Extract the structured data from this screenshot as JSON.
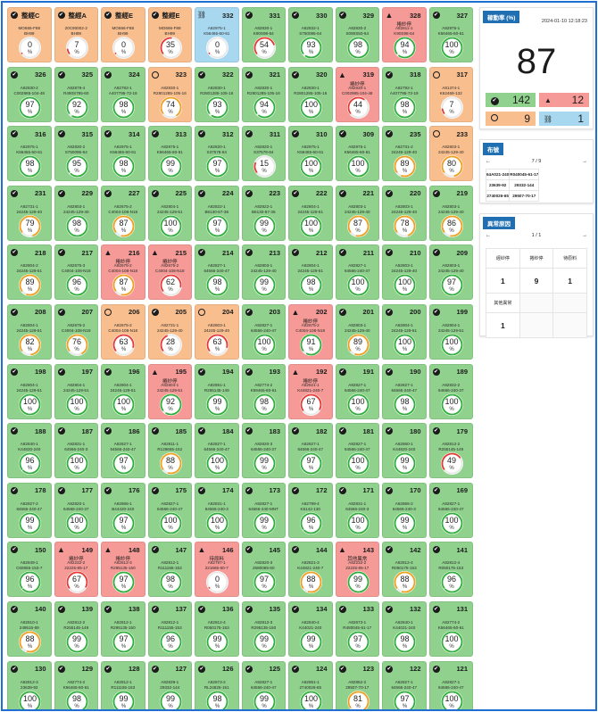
{
  "colors": {
    "green": "#8fd18d",
    "red": "#f59a96",
    "orange": "#f8be8e",
    "blue": "#a8d8f0",
    "accent": "#1f6fb2"
  },
  "tiles": [
    {
      "n": "整經C",
      "st": "ok",
      "c": "orange",
      "l1": "MO666-F88",
      "l2": "BH99",
      "v": "0"
    },
    {
      "n": "整經A",
      "st": "ok",
      "c": "orange",
      "l1": "20C90002-2",
      "l2": "BH99",
      "v": "7"
    },
    {
      "n": "整經E",
      "st": "ok",
      "c": "orange",
      "l1": "MO666-F88",
      "l2": "BH99",
      "v": "0"
    },
    {
      "n": "整經E",
      "st": "ok",
      "c": "orange",
      "l1": "MO666-F88",
      "l2": "BH99",
      "v": "35"
    },
    {
      "n": "332",
      "st": "off",
      "c": "blue",
      "l1": "A82975-1",
      "l2": "K56465-60-61",
      "v": "0"
    },
    {
      "n": "331",
      "st": "ok",
      "c": "green",
      "l1": "A82830-1",
      "l2": "K90S98-64",
      "v": "54"
    },
    {
      "n": "330",
      "st": "ok",
      "c": "green",
      "l1": "A82832-1",
      "l2": "S750095-64",
      "v": "93"
    },
    {
      "n": "329",
      "st": "ok",
      "c": "green",
      "l1": "A82830-2",
      "l2": "S090S50-64",
      "v": "98"
    },
    {
      "n": "328",
      "st": "warn",
      "c": "red",
      "a": "捲紗停",
      "l1": "A82811-1",
      "l2": "K90S98-64",
      "v": "94"
    },
    {
      "n": "327",
      "st": "ok",
      "c": "green",
      "l1": "A82975-1",
      "l2": "K56465-60-61",
      "v": "100"
    },
    {
      "n": "326",
      "st": "ok",
      "c": "green",
      "l1": "A82830-2",
      "l2": "C002985-104-48",
      "v": "97"
    },
    {
      "n": "325",
      "st": "ok",
      "c": "green",
      "l1": "A82879-4",
      "l2": "R490S795-60",
      "v": "92"
    },
    {
      "n": "324",
      "st": "ok",
      "c": "green",
      "l1": "A82792-1",
      "l2": "A407795-73-19",
      "v": "98"
    },
    {
      "n": "323",
      "st": "idle",
      "c": "orange",
      "l1": "A82830-1",
      "l2": "R2801285-105-16",
      "v": "74"
    },
    {
      "n": "322",
      "st": "ok",
      "c": "green",
      "l1": "A82830-1",
      "l2": "R2801285-105-16",
      "v": "93"
    },
    {
      "n": "321",
      "st": "ok",
      "c": "green",
      "l1": "A82830-1",
      "l2": "R2801285-105-16",
      "v": "94"
    },
    {
      "n": "320",
      "st": "ok",
      "c": "green",
      "l1": "A82830-1",
      "l2": "R2801285-105-16",
      "v": "100"
    },
    {
      "n": "319",
      "st": "warn",
      "c": "red",
      "a": "捲紗停",
      "l1": "A82830-1",
      "l2": "C002985-104-48",
      "v": "44"
    },
    {
      "n": "318",
      "st": "ok",
      "c": "green",
      "l1": "A82792-1",
      "l2": "A407795-73-19",
      "v": "98"
    },
    {
      "n": "317",
      "st": "idle",
      "c": "orange",
      "l1": "A81374-1",
      "l2": "K62469-132",
      "v": "7"
    },
    {
      "n": "316",
      "st": "ok",
      "c": "green",
      "l1": "A82975-1",
      "l2": "K56465-60-61",
      "v": "98"
    },
    {
      "n": "315",
      "st": "ok",
      "c": "green",
      "l1": "A82830-2",
      "l2": "S750095-64",
      "v": "95"
    },
    {
      "n": "314",
      "st": "ok",
      "c": "green",
      "l1": "A82975-1",
      "l2": "K56465-60-61",
      "v": "98"
    },
    {
      "n": "313",
      "st": "ok",
      "c": "green",
      "l1": "A82975-1",
      "l2": "K56465-60-61",
      "v": "99"
    },
    {
      "n": "312",
      "st": "ok",
      "c": "green",
      "l1": "A82820-1",
      "l2": "S37578-64",
      "v": "97"
    },
    {
      "n": "311",
      "st": "ok",
      "c": "green",
      "l1": "A82820-1",
      "l2": "S37578-64",
      "v": "15"
    },
    {
      "n": "310",
      "st": "ok",
      "c": "green",
      "l1": "A82975-1",
      "l2": "K56465-60-61",
      "v": "100"
    },
    {
      "n": "309",
      "st": "ok",
      "c": "green",
      "l1": "A82975-1",
      "l2": "K56465-60-61",
      "v": "100"
    },
    {
      "n": "235",
      "st": "ok",
      "c": "green",
      "l1": "A82731-2",
      "l2": "24245-129-40",
      "v": "89"
    },
    {
      "n": "233",
      "st": "idle",
      "c": "orange",
      "l1": "A82803-1",
      "l2": "24245-129-40",
      "v": "80"
    },
    {
      "n": "231",
      "st": "ok",
      "c": "green",
      "l1": "A82731-1",
      "l2": "24245-129-40",
      "v": "79"
    },
    {
      "n": "229",
      "st": "ok",
      "c": "green",
      "l1": "A82803-1",
      "l2": "24245-129-40",
      "v": "98"
    },
    {
      "n": "227",
      "st": "ok",
      "c": "green",
      "l1": "A82675-2",
      "l2": "C4004-108-N18",
      "v": "87"
    },
    {
      "n": "225",
      "st": "ok",
      "c": "green",
      "l1": "A82804-1",
      "l2": "24245-129-51",
      "v": "100"
    },
    {
      "n": "224",
      "st": "ok",
      "c": "green",
      "l1": "A82822-1",
      "l2": "B6130-67-36",
      "v": "97"
    },
    {
      "n": "223",
      "st": "ok",
      "c": "green",
      "l1": "A82822-1",
      "l2": "B6130-67-36",
      "v": "99"
    },
    {
      "n": "222",
      "st": "ok",
      "c": "green",
      "l1": "A82804-1",
      "l2": "24245-129-51",
      "v": "100"
    },
    {
      "n": "221",
      "st": "ok",
      "c": "green",
      "l1": "A82803-1",
      "l2": "24245-129-40",
      "v": "87"
    },
    {
      "n": "220",
      "st": "ok",
      "c": "green",
      "l1": "A82803-1",
      "l2": "24245-129-40",
      "v": "78"
    },
    {
      "n": "219",
      "st": "ok",
      "c": "green",
      "l1": "A82803-1",
      "l2": "24245-129-40",
      "v": "86"
    },
    {
      "n": "218",
      "st": "ok",
      "c": "green",
      "l1": "A82804-2",
      "l2": "24245-129-51",
      "v": "89"
    },
    {
      "n": "217",
      "st": "ok",
      "c": "green",
      "l1": "A82675-3",
      "l2": "C4004-108-N18",
      "v": "96"
    },
    {
      "n": "216",
      "st": "warn",
      "c": "red",
      "a": "捲紗停",
      "l1": "A82675-2",
      "l2": "C4004-108-N18",
      "v": "87"
    },
    {
      "n": "215",
      "st": "warn",
      "c": "red",
      "a": "捲紗停",
      "l1": "A82675-2",
      "l2": "C4004-108-N18",
      "v": "62"
    },
    {
      "n": "214",
      "st": "ok",
      "c": "green",
      "l1": "A82827-1",
      "l2": "64566-240-47",
      "v": "98"
    },
    {
      "n": "213",
      "st": "ok",
      "c": "green",
      "l1": "A82803-1",
      "l2": "24245-129-40",
      "v": "99"
    },
    {
      "n": "212",
      "st": "ok",
      "c": "green",
      "l1": "A82804-1",
      "l2": "24245-129-51",
      "v": "98"
    },
    {
      "n": "211",
      "st": "ok",
      "c": "green",
      "l1": "A82827-1",
      "l2": "64566-240-47",
      "v": "100"
    },
    {
      "n": "210",
      "st": "ok",
      "c": "green",
      "l1": "A82803-1",
      "l2": "24245-129-40",
      "v": "100"
    },
    {
      "n": "209",
      "st": "ok",
      "c": "green",
      "l1": "A82803-1",
      "l2": "24245-129-40",
      "v": "97"
    },
    {
      "n": "208",
      "st": "ok",
      "c": "green",
      "l1": "A82804-1",
      "l2": "24245-129-51",
      "v": "82"
    },
    {
      "n": "207",
      "st": "ok",
      "c": "green",
      "l1": "A82675-2",
      "l2": "C4004-108-N18",
      "v": "76"
    },
    {
      "n": "206",
      "st": "idle",
      "c": "orange",
      "l1": "A82675-2",
      "l2": "C4004-108-N18",
      "v": "63"
    },
    {
      "n": "205",
      "st": "ok",
      "c": "orange",
      "l1": "A82731-1",
      "l2": "24245-129-40",
      "v": "28"
    },
    {
      "n": "204",
      "st": "idle",
      "c": "orange",
      "l1": "A82803-1",
      "l2": "24245-129-40",
      "v": "63"
    },
    {
      "n": "203",
      "st": "ok",
      "c": "green",
      "l1": "A82827-1",
      "l2": "64566-240-47",
      "v": "100"
    },
    {
      "n": "202",
      "st": "warn",
      "c": "red",
      "a": "捲紗停",
      "l1": "A82675-2",
      "l2": "C4004-108-N18",
      "v": "91"
    },
    {
      "n": "201",
      "st": "ok",
      "c": "green",
      "l1": "A82803-1",
      "l2": "24245-129-40",
      "v": "89"
    },
    {
      "n": "200",
      "st": "ok",
      "c": "green",
      "l1": "A82804-1",
      "l2": "24245-129-51",
      "v": "100"
    },
    {
      "n": "199",
      "st": "ok",
      "c": "green",
      "l1": "A82804-1",
      "l2": "24245-129-51",
      "v": "100"
    },
    {
      "n": "198",
      "st": "ok",
      "c": "green",
      "l1": "A82804-1",
      "l2": "24245-129-51",
      "v": "100"
    },
    {
      "n": "197",
      "st": "ok",
      "c": "green",
      "l1": "A82804-1",
      "l2": "24245-129-51",
      "v": "100"
    },
    {
      "n": "196",
      "st": "ok",
      "c": "green",
      "l1": "A82804-1",
      "l2": "24245-129-51",
      "v": "100"
    },
    {
      "n": "195",
      "st": "warn",
      "c": "red",
      "a": "捲紗停",
      "l1": "A82804-1",
      "l2": "24245-129-51",
      "v": "92"
    },
    {
      "n": "194",
      "st": "ok",
      "c": "green",
      "l1": "A82851-1",
      "l2": "R255145-149",
      "v": "99"
    },
    {
      "n": "193",
      "st": "ok",
      "c": "green",
      "l1": "A82774-2",
      "l2": "K59465-60-61",
      "v": "98"
    },
    {
      "n": "192",
      "st": "warn",
      "c": "red",
      "a": "捲紗停",
      "l1": "A82821-1",
      "l2": "K44821-240-7",
      "v": "67"
    },
    {
      "n": "191",
      "st": "ok",
      "c": "green",
      "l1": "A82827-1",
      "l2": "64566-240-47",
      "v": "100"
    },
    {
      "n": "190",
      "st": "ok",
      "c": "green",
      "l1": "A82827-1",
      "l2": "64566-240-47",
      "v": "98"
    },
    {
      "n": "189",
      "st": "ok",
      "c": "green",
      "l1": "A82832-2",
      "l2": "64566-240-37",
      "v": "100"
    },
    {
      "n": "188",
      "st": "ok",
      "c": "green",
      "l1": "A82840-1",
      "l2": "K44820-240",
      "v": "96"
    },
    {
      "n": "187",
      "st": "ok",
      "c": "green",
      "l1": "A82831-1",
      "l2": "64566-240-3",
      "v": "100"
    },
    {
      "n": "186",
      "st": "ok",
      "c": "green",
      "l1": "A82827-1",
      "l2": "64566-240-47",
      "v": "97"
    },
    {
      "n": "185",
      "st": "ok",
      "c": "green",
      "l1": "A82811-1",
      "l2": "R129665-152",
      "v": "88"
    },
    {
      "n": "184",
      "st": "ok",
      "c": "green",
      "l1": "A82827-1",
      "l2": "64566-240-47",
      "v": "100"
    },
    {
      "n": "183",
      "st": "ok",
      "c": "green",
      "l1": "A82820-3",
      "l2": "64566-240-37",
      "v": "99"
    },
    {
      "n": "182",
      "st": "ok",
      "c": "green",
      "l1": "A82827-1",
      "l2": "64566-240-47",
      "v": "97"
    },
    {
      "n": "181",
      "st": "ok",
      "c": "green",
      "l1": "A82827-1",
      "l2": "64566-240-47",
      "v": "100"
    },
    {
      "n": "180",
      "st": "ok",
      "c": "green",
      "l1": "A82860-1",
      "l2": "K44820-240",
      "v": "99"
    },
    {
      "n": "179",
      "st": "ok",
      "c": "green",
      "l1": "A82812-2",
      "l2": "R255145-149",
      "v": "49"
    },
    {
      "n": "178",
      "st": "ok",
      "c": "green",
      "l1": "A82827-2",
      "l2": "64566-240-47",
      "v": "99"
    },
    {
      "n": "177",
      "st": "ok",
      "c": "green",
      "l1": "A82820-1",
      "l2": "64566-240-37",
      "v": "100"
    },
    {
      "n": "176",
      "st": "ok",
      "c": "green",
      "l1": "A82866-1",
      "l2": "B44420-240",
      "v": "97"
    },
    {
      "n": "175",
      "st": "ok",
      "c": "green",
      "l1": "A82827-1",
      "l2": "64566-240-47",
      "v": "100"
    },
    {
      "n": "174",
      "st": "ok",
      "c": "green",
      "l1": "A82831-1",
      "l2": "64566-240-3",
      "v": "100"
    },
    {
      "n": "173",
      "st": "ok",
      "c": "green",
      "l1": "A82827-1",
      "l2": "64566-240-MNT",
      "v": "99"
    },
    {
      "n": "172",
      "st": "ok",
      "c": "green",
      "l1": "A82799-4",
      "l2": "K5142-130",
      "v": "96"
    },
    {
      "n": "171",
      "st": "ok",
      "c": "green",
      "l1": "A82831-1",
      "l2": "64566-240-3",
      "v": "100"
    },
    {
      "n": "170",
      "st": "ok",
      "c": "green",
      "l1": "A82866-2",
      "l2": "64566-240-3",
      "v": "99"
    },
    {
      "n": "169",
      "st": "ok",
      "c": "green",
      "l1": "A82827-1",
      "l2": "64566-240-47",
      "v": "100"
    },
    {
      "n": "150",
      "st": "ok",
      "c": "green",
      "l1": "A82849-1",
      "l2": "C60855-153-7",
      "v": "96"
    },
    {
      "n": "149",
      "st": "warn",
      "c": "red",
      "a": "捲紗停",
      "l1": "A82232-2",
      "l2": "22225-85-17",
      "v": "67"
    },
    {
      "n": "148",
      "st": "warn",
      "c": "red",
      "a": "捲紗停",
      "l1": "A82812-3",
      "l2": "R295135-150",
      "v": "97"
    },
    {
      "n": "147",
      "st": "ok",
      "c": "green",
      "l1": "A82812-1",
      "l2": "R111155-153",
      "v": "98"
    },
    {
      "n": "146",
      "st": "warn",
      "c": "red",
      "a": "待原料",
      "l1": "A82797-1",
      "l2": "221665-60-7",
      "v": "0"
    },
    {
      "n": "145",
      "st": "ok",
      "c": "green",
      "l1": "A82820-3",
      "l2": "2580065-60",
      "v": "97"
    },
    {
      "n": "144",
      "st": "ok",
      "c": "green",
      "l1": "A82821-3",
      "l2": "K44821-240-7",
      "v": "88"
    },
    {
      "n": "143",
      "st": "warn",
      "c": "red",
      "a": "其他異常",
      "l1": "A82232-2",
      "l2": "22225-85-17",
      "v": "99"
    },
    {
      "n": "142",
      "st": "ok",
      "c": "green",
      "l1": "A82812-4",
      "l2": "R050175-153",
      "v": "88"
    },
    {
      "n": "141",
      "st": "ok",
      "c": "green",
      "l1": "A82812-4",
      "l2": "R050175-153",
      "v": "96"
    },
    {
      "n": "140",
      "st": "ok",
      "c": "green",
      "l1": "A82810-1",
      "l2": "249515-69",
      "v": "88"
    },
    {
      "n": "139",
      "st": "ok",
      "c": "green",
      "l1": "A82812-2",
      "l2": "R255145-149",
      "v": "99"
    },
    {
      "n": "138",
      "st": "ok",
      "c": "green",
      "l1": "A82812-1",
      "l2": "R295135-150",
      "v": "97"
    },
    {
      "n": "137",
      "st": "ok",
      "c": "green",
      "l1": "A82812-1",
      "l2": "R111155-153",
      "v": "96"
    },
    {
      "n": "136",
      "st": "ok",
      "c": "green",
      "l1": "A82812-4",
      "l2": "R050175-153",
      "v": "99"
    },
    {
      "n": "135",
      "st": "ok",
      "c": "green",
      "l1": "A82812-3",
      "l2": "R295135-150",
      "v": "99"
    },
    {
      "n": "134",
      "st": "ok",
      "c": "green",
      "l1": "A82840-4",
      "l2": "K44021-240",
      "v": "99"
    },
    {
      "n": "133",
      "st": "ok",
      "c": "green",
      "l1": "A82673-1",
      "l2": "R480045-61-17",
      "v": "97"
    },
    {
      "n": "132",
      "st": "ok",
      "c": "green",
      "l1": "A82840-1",
      "l2": "K44021-240",
      "v": "98"
    },
    {
      "n": "131",
      "st": "ok",
      "c": "green",
      "l1": "A82774-2",
      "l2": "K56465-60-61",
      "v": "100"
    },
    {
      "n": "130",
      "st": "ok",
      "c": "green",
      "l1": "A82812-3",
      "l2": "23639-92",
      "v": "100"
    },
    {
      "n": "129",
      "st": "ok",
      "c": "green",
      "l1": "A82774-2",
      "l2": "K56465-60-61",
      "v": "98"
    },
    {
      "n": "128",
      "st": "ok",
      "c": "green",
      "l1": "A82812-1",
      "l2": "R111155-153",
      "v": "99"
    },
    {
      "n": "127",
      "st": "ok",
      "c": "green",
      "l1": "A82839-1",
      "l2": "29332-144",
      "v": "99"
    },
    {
      "n": "126",
      "st": "ok",
      "c": "green",
      "l1": "A82673-2",
      "l2": "RL24825-151",
      "v": "98"
    },
    {
      "n": "125",
      "st": "ok",
      "c": "green",
      "l1": "A82827-1",
      "l2": "64566-240-47",
      "v": "99"
    },
    {
      "n": "124",
      "st": "ok",
      "c": "green",
      "l1": "A82851-1",
      "l2": "2740026-65",
      "v": "100"
    },
    {
      "n": "123",
      "st": "ok",
      "c": "green",
      "l1": "A82852-2",
      "l2": "29507-70-17",
      "v": "81"
    },
    {
      "n": "122",
      "st": "ok",
      "c": "green",
      "l1": "A82827-1",
      "l2": "64566-240-47",
      "v": "97"
    },
    {
      "n": "121",
      "st": "ok",
      "c": "green",
      "l1": "A82827-1",
      "l2": "64566-240-47",
      "v": "100"
    }
  ],
  "side": {
    "rate_title": "稼動率 (%)",
    "timestamp": "2024-01-10 12:18:23",
    "rate_value": "87",
    "counts": {
      "ok": "142",
      "warn": "12",
      "idle": "9",
      "off": "1"
    },
    "cloth_title": "布號",
    "cloth_pager": {
      "prev": "←",
      "page": "7",
      "sep": "/",
      "total": "9",
      "next": "→"
    },
    "cloth_rows": [
      [
        "64A021-240",
        "R040045-61-17"
      ],
      [
        "23639-92",
        "29332-144"
      ],
      [
        "2740026-65",
        "29507-70-17"
      ]
    ],
    "reason_title": "異常原因",
    "reason_pager": {
      "prev": "←",
      "page": "1",
      "sep": "/",
      "total": "1",
      "next": "→"
    },
    "reasons": {
      "h1": [
        "經紗停",
        "捲紗停",
        "待原料"
      ],
      "v1": [
        "1",
        "9",
        "1"
      ],
      "h2": [
        "其他異常",
        "",
        ""
      ],
      "v2": [
        "1",
        "",
        ""
      ]
    }
  }
}
